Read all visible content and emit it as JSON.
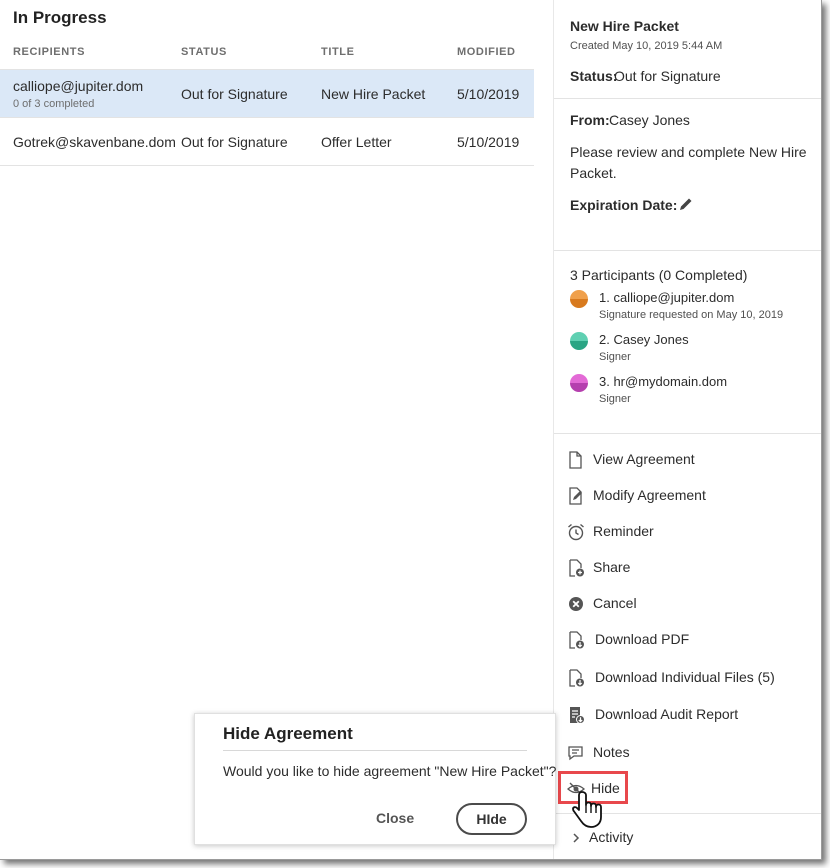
{
  "page": {
    "title": "In Progress"
  },
  "table": {
    "headers": {
      "recipients": "RECIPIENTS",
      "status": "STATUS",
      "title": "TITLE",
      "modified": "MODIFIED"
    },
    "rows": [
      {
        "recipient": "calliope@jupiter.dom",
        "progress": "0 of 3 completed",
        "status": "Out for Signature",
        "title": "New Hire Packet",
        "modified": "5/10/2019",
        "selected": true
      },
      {
        "recipient": "Gotrek@skavenbane.dom",
        "status": "Out for Signature",
        "title": "Offer Letter",
        "modified": "5/10/2019",
        "selected": false
      }
    ]
  },
  "details": {
    "name": "New Hire Packet",
    "created": "Created May 10, 2019 5:44 AM",
    "status_label": "Status:",
    "status_value": "Out for Signature",
    "from_label": "From:",
    "from_value": "Casey Jones",
    "message_line1": "Please review and complete New Hire",
    "message_line2": "Packet.",
    "expiration_label": "Expiration Date:",
    "participants_header": "3 Participants (0 Completed)",
    "participants": [
      {
        "name": "1. calliope@jupiter.dom",
        "role": "Signature requested on May 10, 2019",
        "color_top": "#f0a04b",
        "color_bottom": "#d87a1e"
      },
      {
        "name": "2. Casey Jones",
        "role": "Signer",
        "color_top": "#5fd0b2",
        "color_bottom": "#2aa584"
      },
      {
        "name": "3. hr@mydomain.dom",
        "role": "Signer",
        "color_top": "#e36ad6",
        "color_bottom": "#b53fae"
      }
    ]
  },
  "actions": {
    "view": "View Agreement",
    "modify": "Modify Agreement",
    "reminder": "Reminder",
    "share": "Share",
    "cancel": "Cancel",
    "download_pdf": "Download PDF",
    "download_individual": "Download Individual Files (5)",
    "download_audit": "Download Audit Report",
    "notes": "Notes",
    "hide": "Hide",
    "activity": "Activity"
  },
  "dialog": {
    "title": "Hide Agreement",
    "message": "Would you like to hide agreement \"New Hire Packet\"?",
    "close_label": "Close",
    "confirm_label": "HIde"
  },
  "colors": {
    "selected_row": "#dbe8f7",
    "highlight": "#e8484c"
  }
}
